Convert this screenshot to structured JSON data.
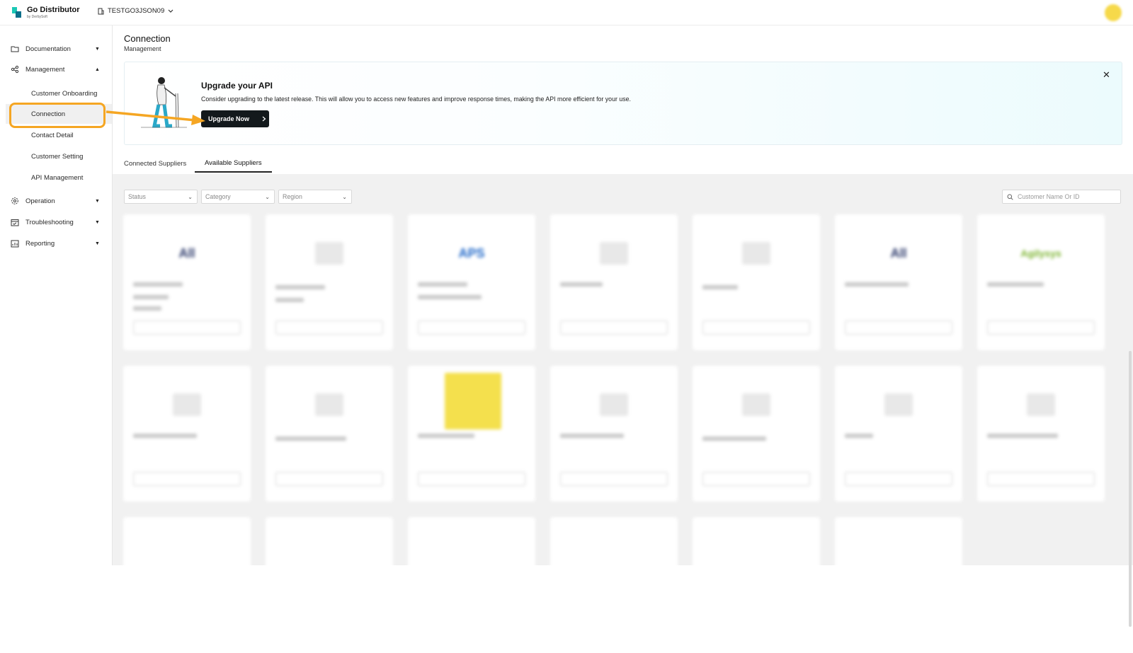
{
  "app": {
    "name": "Go Distributor",
    "sub": "by DerbySoft",
    "account": "TESTGO3JSON09"
  },
  "sidebar": {
    "items": [
      {
        "label": "Documentation"
      },
      {
        "label": "Management"
      },
      {
        "label": "Operation"
      },
      {
        "label": "Troubleshooting"
      },
      {
        "label": "Reporting"
      }
    ],
    "management_children": [
      {
        "label": "Customer Onboarding"
      },
      {
        "label": "Connection"
      },
      {
        "label": "Contact Detail"
      },
      {
        "label": "Customer Setting"
      },
      {
        "label": "API Management"
      }
    ]
  },
  "header": {
    "title": "Connection",
    "breadcrumb": "Management"
  },
  "banner": {
    "title": "Upgrade your API",
    "text": "Consider upgrading to the latest release. This will allow you to access new features and improve response times, making the API more efficient for your use.",
    "button": "Upgrade Now"
  },
  "tabs": [
    {
      "label": "Connected Suppliers"
    },
    {
      "label": "Available Suppliers"
    }
  ],
  "filters": {
    "status": "Status",
    "category": "Category",
    "region": "Region",
    "search_placeholder": "Customer Name Or ID"
  },
  "colors": {
    "accent": "#f5a623",
    "button_dark": "#13191c",
    "brand_teal": "#1bc8b5"
  },
  "icons": {
    "close": "close-icon",
    "search": "search-icon",
    "chevron": "chevron-down-icon"
  }
}
